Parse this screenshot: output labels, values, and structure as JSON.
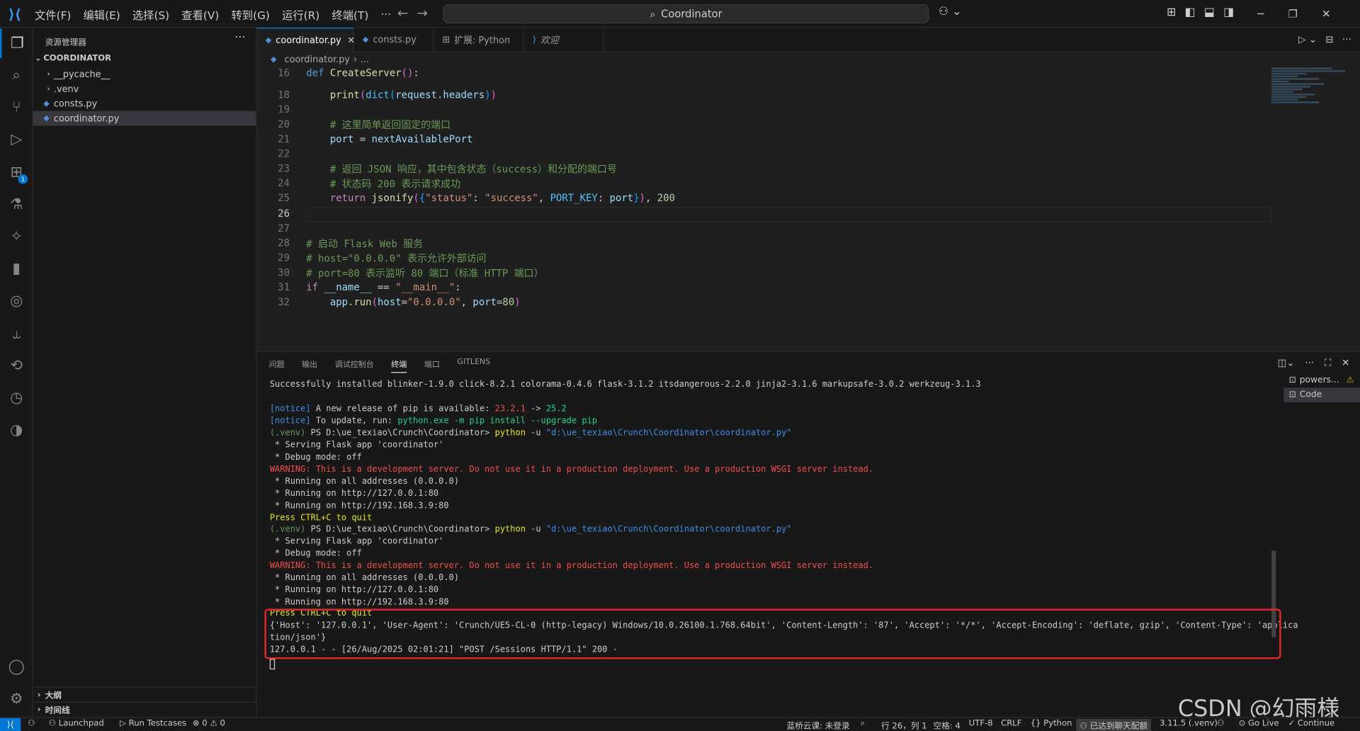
{
  "titlebar": {
    "menus": [
      "文件(F)",
      "编辑(E)",
      "选择(S)",
      "查看(V)",
      "转到(G)",
      "运行(R)",
      "终端(T)",
      "···"
    ],
    "search": "Coordinator"
  },
  "explorer": {
    "title": "资源管理器",
    "root": "COORDINATOR",
    "items": [
      {
        "label": "__pycache__",
        "type": "folder"
      },
      {
        "label": ".venv",
        "type": "folder"
      },
      {
        "label": "consts.py",
        "type": "file"
      },
      {
        "label": "coordinator.py",
        "type": "file",
        "selected": true
      }
    ],
    "outline": "大纲",
    "timeline": "时间线"
  },
  "activity_badge": "1",
  "tabs": [
    {
      "label": "coordinator.py",
      "active": true
    },
    {
      "label": "consts.py"
    },
    {
      "label": "扩展: Python"
    },
    {
      "label": "欢迎"
    }
  ],
  "breadcrumb": [
    "coordinator.py",
    "..."
  ],
  "editor": {
    "lines": [
      {
        "n": "16",
        "html": "<span class='kw'>def</span> <span class='fn'>CreateServer</span><span class='brk'>()</span>:"
      },
      {
        "n": "18",
        "html": "    <span class='fn'>print</span><span class='brk'>(</span><span class='cst'>dict</span><span class='brk2'>(</span><span class='var'>request</span>.<span class='var'>headers</span><span class='brk2'>)</span><span class='brk'>)</span>"
      },
      {
        "n": "19",
        "html": ""
      },
      {
        "n": "20",
        "html": "    <span class='cm'># 这里简单返回固定的端口</span>"
      },
      {
        "n": "21",
        "html": "    <span class='var'>port</span> = <span class='var'>nextAvailablePort</span>"
      },
      {
        "n": "22",
        "html": ""
      },
      {
        "n": "23",
        "html": "    <span class='cm'># 返回 JSON 响应，其中包含状态（success）和分配的端口号</span>"
      },
      {
        "n": "24",
        "html": "    <span class='cm'># 状态码 200 表示请求成功</span>"
      },
      {
        "n": "25",
        "html": "    <span class='ctl'>return</span> <span class='fn'>jsonify</span><span class='brk'>(</span><span class='brk2'>{</span><span class='str'>\"status\"</span>: <span class='str'>\"success\"</span>, <span class='cst'>PORT_KEY</span>: <span class='var'>port</span><span class='brk2'>}</span><span class='brk'>)</span>, <span class='num'>200</span>"
      },
      {
        "n": "26",
        "html": "",
        "current": true
      },
      {
        "n": "27",
        "html": ""
      },
      {
        "n": "28",
        "html": "<span class='cm'># 启动 Flask Web 服务</span>"
      },
      {
        "n": "29",
        "html": "<span class='cm'># host=\"0.0.0.0\" 表示允许外部访问</span>"
      },
      {
        "n": "30",
        "html": "<span class='cm'># port=80 表示监听 80 端口（标准 HTTP 端口）</span>"
      },
      {
        "n": "31",
        "html": "<span class='ctl'>if</span> <span class='var'>__name__</span> == <span class='str'>\"__main__\"</span>:"
      },
      {
        "n": "32",
        "html": "    <span class='var'>app</span>.<span class='fn'>run</span><span class='brk'>(</span><span class='var'>host</span>=<span class='str'>\"0.0.0.0\"</span>, <span class='var'>port</span>=<span class='num'>80</span><span class='brk'>)</span>"
      }
    ]
  },
  "panel": {
    "tabs": [
      "问题",
      "输出",
      "调试控制台",
      "终端",
      "端口",
      "GITLENS"
    ],
    "active_tab": "终端",
    "terminal_lines": [
      "Successfully installed blinker-1.9.0 click-8.2.1 colorama-0.4.6 flask-3.1.2 itsdangerous-2.2.0 jinja2-3.1.6 markupsafe-3.0.2 werkzeug-3.1.3",
      "",
      "<span class='b'>[notice]</span> A new release of pip is available: <span class='r'>23.2.1</span> -> <span class='g'>25.2</span>",
      "<span class='b'>[notice]</span> To update, run: <span class='g'>python.exe -m pip install --upgrade pip</span>",
      "<span class='grn'>(.venv)</span> PS D:\\ue_texiao\\Crunch\\Coordinator> <span class='y'>python</span> -u <span class='b'>\"d:\\ue_texiao\\Crunch\\Coordinator\\coordinator.py\"</span>",
      " * Serving Flask app 'coordinator'",
      " * Debug mode: off",
      "<span class='r'>WARNING: This is a development server. Do not use it in a production deployment. Use a production WSGI server instead.</span>",
      " * Running on all addresses (0.0.0.0)",
      " * Running on http://127.0.0.1:80",
      " * Running on http://192.168.3.9:80",
      "<span class='y'>Press CTRL+C to quit</span>",
      "<span class='grn'>(.venv)</span> PS D:\\ue_texiao\\Crunch\\Coordinator> <span class='y'>python</span> -u <span class='b'>\"d:\\ue_texiao\\Crunch\\Coordinator\\coordinator.py\"</span>",
      " * Serving Flask app 'coordinator'",
      " * Debug mode: off",
      "<span class='r'>WARNING: This is a development server. Do not use it in a production deployment. Use a production WSGI server instead.</span>",
      " * Running on all addresses (0.0.0.0)",
      " * Running on http://127.0.0.1:80",
      " * Running on http://192.168.3.9:80",
      "<span class='y'>Press CTRL+C to quit</span>",
      "{'Host': '127.0.0.1', 'User-Agent': 'Crunch/UE5-CL-0 (http-legacy) Windows/10.0.26100.1.768.64bit', 'Content-Length': '87', 'Accept': '*/*', 'Accept-Encoding': 'deflate, gzip', 'Content-Type': 'applica",
      "tion/json'}",
      "127.0.0.1 - - [26/Aug/2025 02:01:21] \"POST /Sessions HTTP/1.1\" 200 -"
    ],
    "terminals": [
      "powers...",
      "Code"
    ]
  },
  "status": {
    "launchpad": "Launchpad",
    "testcases": "Run Testcases",
    "problems": "⊗ 0  ⚠ 0",
    "cloud": "蓝桥云课: 未登录",
    "position": "行 26，列 1",
    "spaces": "空格: 4",
    "encoding": "UTF-8",
    "eol": "CRLF",
    "language": "{} Python",
    "chat": "已达到聊天配额",
    "interpreter": "3.11.5 (.venv)",
    "golive": "Go Live",
    "continue": "✓ Continue"
  },
  "watermark": "CSDN @幻雨様"
}
